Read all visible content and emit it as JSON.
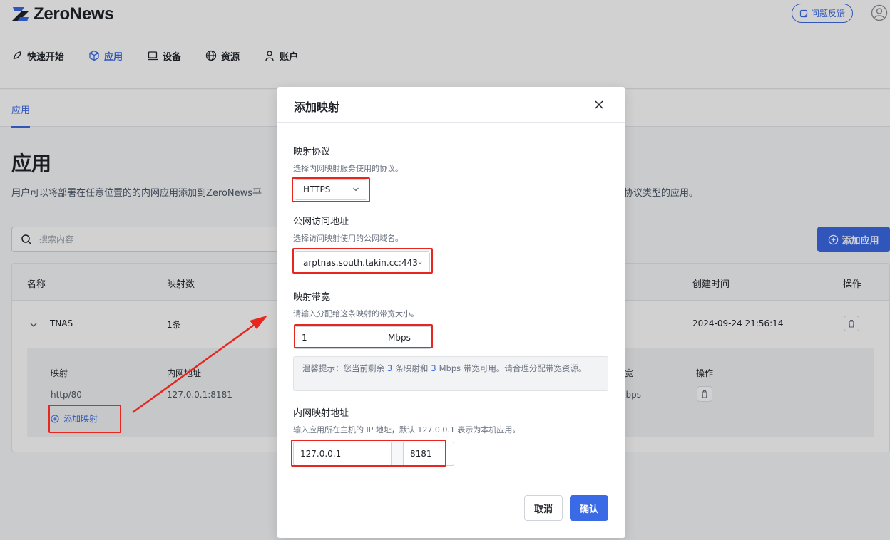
{
  "app": {
    "name": "ZeroNews",
    "feedback_label": "问题反馈"
  },
  "nav": {
    "items": [
      {
        "label": "快速开始",
        "icon": "rocket-icon"
      },
      {
        "label": "应用",
        "icon": "cube-icon",
        "active": true
      },
      {
        "label": "设备",
        "icon": "laptop-icon"
      },
      {
        "label": "资源",
        "icon": "globe-icon"
      },
      {
        "label": "账户",
        "icon": "user-icon"
      }
    ]
  },
  "subtab": {
    "label": "应用"
  },
  "page": {
    "title": "应用",
    "description": "用户可以将部署在任意位置的的内网应用添加到ZeroNews平",
    "description_tail": "协议类型的应用。",
    "search_placeholder": "搜索内容",
    "add_app_label": "添加应用"
  },
  "table": {
    "headers": {
      "name": "名称",
      "mappings": "映射数",
      "created": "创建时间",
      "actions": "操作"
    },
    "row": {
      "name": "TNAS",
      "mappings": "1条",
      "created": "2024-09-24 21:56:14"
    },
    "subtable": {
      "headers": {
        "mapping": "映射",
        "internal": "内网地址",
        "bandwidth": "宽",
        "actions": "操作"
      },
      "row": {
        "mapping": "http/80",
        "internal": "127.0.0.1:8181",
        "bandwidth": "Ibps"
      },
      "add_mapping_label": "添加映射"
    }
  },
  "modal": {
    "title": "添加映射",
    "protocol": {
      "label": "映射协议",
      "hint": "选择内网映射服务使用的协议。",
      "value": "HTTPS"
    },
    "public_address": {
      "label": "公网访问地址",
      "hint": "选择访问映射使用的公网域名。",
      "value": "arptnas.south.takin.cc:443"
    },
    "bandwidth": {
      "label": "映射带宽",
      "hint": "请输入分配给这条映射的带宽大小。",
      "value": "1",
      "unit": "Mbps"
    },
    "tip": {
      "prefix": "温馨提示：您当前剩余",
      "remaining_mappings": "3",
      "middle": "条映射和",
      "remaining_bandwidth": "3",
      "suffix": "Mbps 带宽可用。请合理分配带宽资源。"
    },
    "internal_address": {
      "label": "内网映射地址",
      "hint": "输入应用所在主机的 IP 地址，默认 127.0.0.1 表示为本机应用。",
      "ip": "127.0.0.1",
      "port": "8181"
    },
    "cancel_label": "取消",
    "confirm_label": "确认"
  },
  "colors": {
    "accent": "#3b6ae6",
    "annotation": "#e8261f"
  }
}
